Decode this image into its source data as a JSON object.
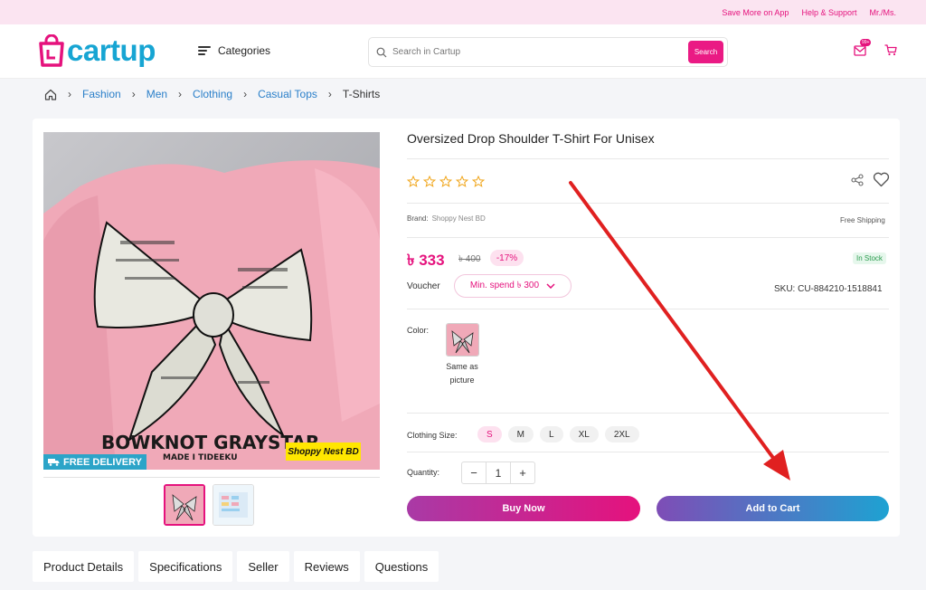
{
  "topbar": {
    "links": [
      "Save More on App",
      "Help & Support",
      "Mr./Ms."
    ]
  },
  "header": {
    "logo_text": "cartup",
    "categories_label": "Categories",
    "search_placeholder": "Search in Cartup",
    "search_button": "Search",
    "message_badge": "99+"
  },
  "breadcrumb": [
    "Fashion",
    "Men",
    "Clothing",
    "Casual Tops",
    "T-Shirts"
  ],
  "gallery": {
    "delivery_badge": "FREE DELIVERY",
    "shop_label": "Shoppy Nest BD",
    "shirt_print": [
      "BOWKNOT GRAYSTAR",
      "MADE I TIDEEKU"
    ]
  },
  "product": {
    "title": "Oversized Drop Shoulder T-Shirt For Unisex",
    "rating_stars": 0,
    "brand_label": "Brand:",
    "brand_value": "Shoppy Nest BD",
    "free_shipping": "Free Shipping",
    "price": "৳ 333",
    "old_price": "৳ 400",
    "discount": "-17%",
    "stock": "In Stock",
    "voucher_label": "Voucher",
    "voucher_value": "Min. spend ৳ 300",
    "sku": "SKU: CU-884210-1518841",
    "color_label": "Color:",
    "color_value": "Same as picture",
    "size_label": "Clothing Size:",
    "sizes": [
      "S",
      "M",
      "L",
      "XL",
      "2XL"
    ],
    "selected_size": "S",
    "quantity_label": "Quantity:",
    "quantity": "1",
    "buy_now": "Buy Now",
    "add_to_cart": "Add to Cart"
  },
  "tabs": [
    "Product Details",
    "Specifications",
    "Seller",
    "Reviews",
    "Questions"
  ],
  "colors": {
    "brand_pink": "#e5127d",
    "brand_blue": "#17a5d3",
    "annotation_arrow": "#e02020"
  }
}
